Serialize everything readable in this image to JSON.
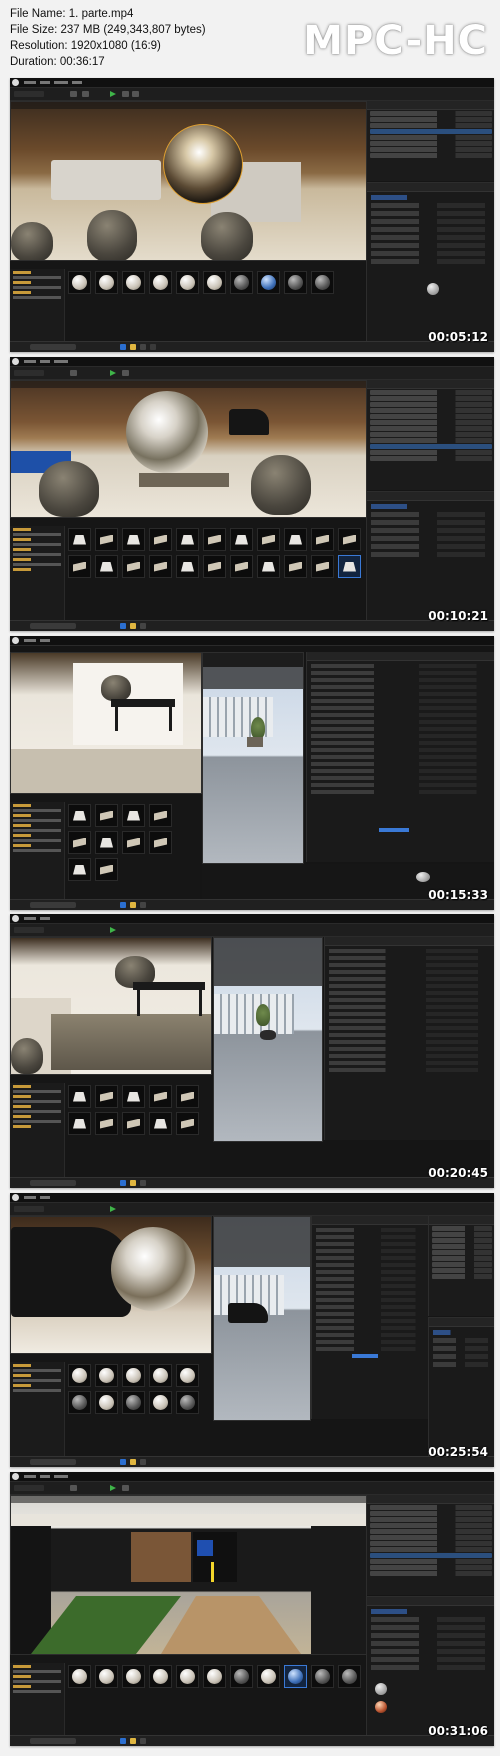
{
  "header": {
    "file_name": "File Name: 1. parte.mp4",
    "file_size": "File Size: 237 MB (249,343,807 bytes)",
    "resolution": "Resolution: 1920x1080 (16:9)",
    "duration": "Duration: 00:36:17"
  },
  "logo": "MPC-HC",
  "frames": [
    {
      "timestamp": "00:05:12"
    },
    {
      "timestamp": "00:10:21"
    },
    {
      "timestamp": "00:15:33"
    },
    {
      "timestamp": "00:20:45"
    },
    {
      "timestamp": "00:25:54"
    },
    {
      "timestamp": "00:31:06"
    }
  ],
  "colors": {
    "accent_blue": "#3a79d6",
    "play_green": "#3fb449",
    "folder_yellow": "#c79a3a"
  }
}
